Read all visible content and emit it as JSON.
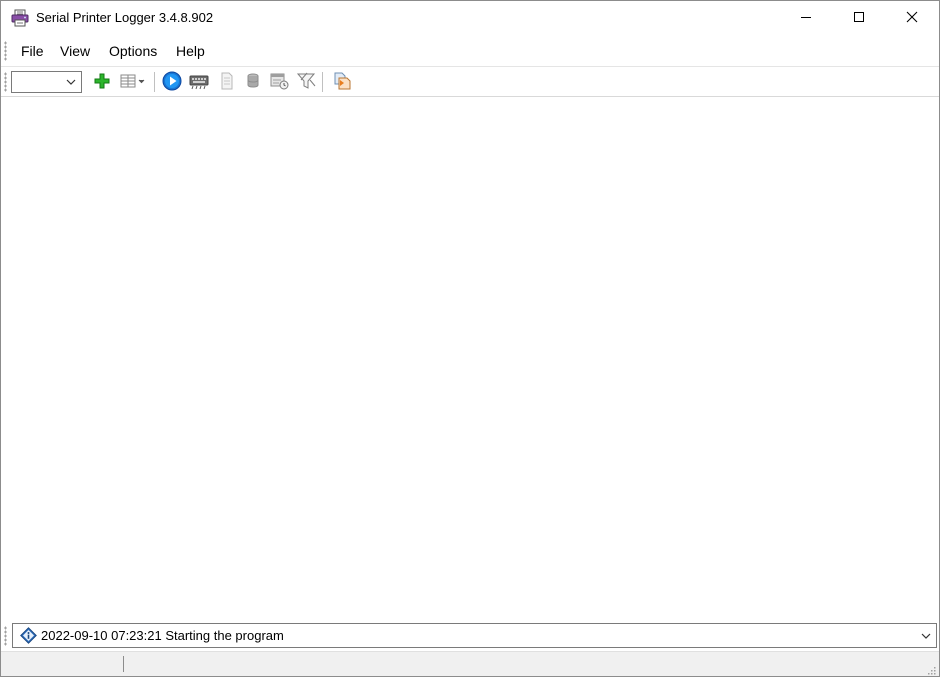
{
  "window": {
    "title": "Serial Printer Logger 3.4.8.902",
    "app_icon": "printer-logger-app-icon",
    "controls": {
      "minimize_icon": "minimize-icon",
      "maximize_icon": "maximize-icon",
      "close_icon": "close-icon"
    }
  },
  "menu": {
    "items": [
      {
        "label": "File"
      },
      {
        "label": "View"
      },
      {
        "label": "Options"
      },
      {
        "label": "Help"
      }
    ]
  },
  "toolbar": {
    "port_select_value": "",
    "buttons": [
      {
        "icon": "add-icon",
        "enabled": true
      },
      {
        "icon": "columns-view-icon",
        "enabled": true
      },
      {
        "icon": "start-icon",
        "enabled": true
      },
      {
        "icon": "keyboard-icon",
        "enabled": false
      },
      {
        "icon": "document-icon",
        "enabled": false
      },
      {
        "icon": "database-icon",
        "enabled": false
      },
      {
        "icon": "schedule-icon",
        "enabled": false
      },
      {
        "icon": "filter-icon",
        "enabled": false
      },
      {
        "icon": "export-icon",
        "enabled": true
      }
    ]
  },
  "log": {
    "entry_icon": "info-diamond-icon",
    "latest_entry": "2022-09-10 07:23:21 Starting the program"
  },
  "statusbar": {
    "panel_1": "",
    "panel_2": ""
  },
  "colors": {
    "add_green": "#1faa1f",
    "start_blue": "#1565c0",
    "export_orange": "#e87d1e",
    "disabled_gray": "#9a9a9a"
  }
}
